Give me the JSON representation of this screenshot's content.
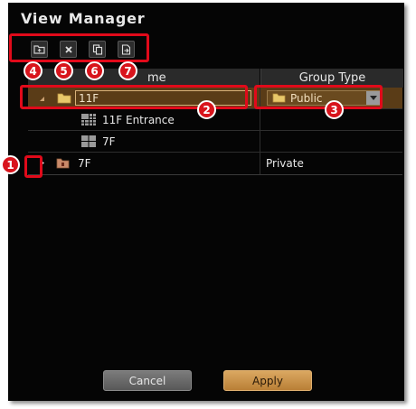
{
  "window": {
    "title": "View Manager"
  },
  "toolbar": {
    "buttons": [
      {
        "name": "new-group",
        "icon": "folder-plus-icon"
      },
      {
        "name": "delete",
        "icon": "close-icon"
      },
      {
        "name": "copy",
        "icon": "copy-icon"
      },
      {
        "name": "export",
        "icon": "export-icon"
      }
    ]
  },
  "table": {
    "columns": [
      "me",
      "Group Type"
    ],
    "rows": [
      {
        "name_value": "11F",
        "group_type_value": "Public",
        "expanded": true
      },
      {
        "name": "11F Entrance",
        "group_type": ""
      },
      {
        "name": "7F",
        "group_type": ""
      },
      {
        "name": "7F",
        "group_type": "Private",
        "expanded": false
      }
    ]
  },
  "callouts": [
    "1",
    "2",
    "3",
    "4",
    "5",
    "6",
    "7"
  ],
  "footer": {
    "cancel_label": "Cancel",
    "apply_label": "Apply"
  },
  "colors": {
    "callout_red": "#d8141c",
    "selected_row": "#5a3c17",
    "apply_button": "#c99044",
    "cancel_button": "#6a6a6a"
  }
}
